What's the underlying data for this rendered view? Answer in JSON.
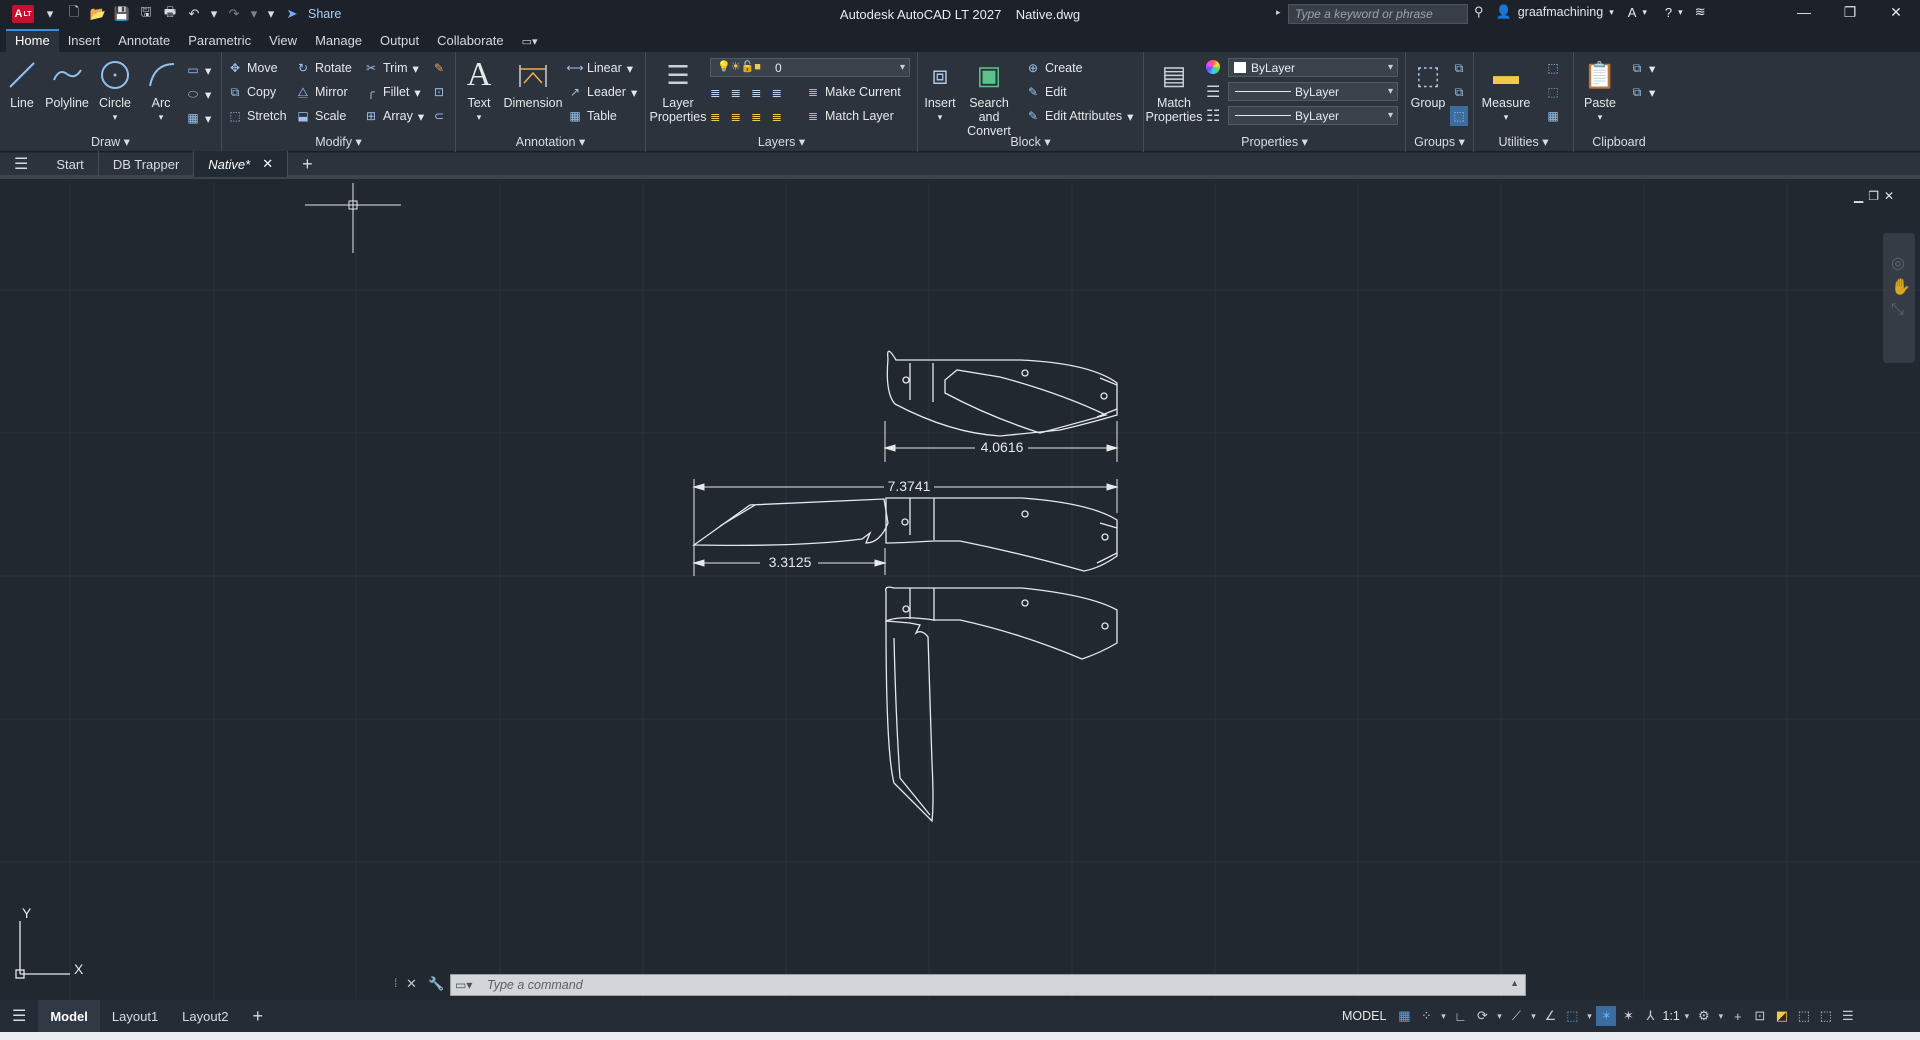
{
  "app": {
    "logo": "A",
    "logo_sub": "LT",
    "title": "Autodesk AutoCAD LT 2027    Native.dwg",
    "share_label": "Share",
    "search_placeholder": "Type a keyword or phrase",
    "user": "graafmachining"
  },
  "ribbon_tabs": [
    "Home",
    "Insert",
    "Annotate",
    "Parametric",
    "View",
    "Manage",
    "Output",
    "Collaborate"
  ],
  "ribbon": {
    "draw": {
      "title": "Draw",
      "line": "Line",
      "polyline": "Polyline",
      "circle": "Circle",
      "arc": "Arc"
    },
    "modify": {
      "title": "Modify",
      "move": "Move",
      "rotate": "Rotate",
      "trim": "Trim",
      "copy": "Copy",
      "mirror": "Mirror",
      "fillet": "Fillet",
      "stretch": "Stretch",
      "scale": "Scale",
      "array": "Array"
    },
    "annotation": {
      "title": "Annotation",
      "text": "Text",
      "dimension": "Dimension",
      "linear": "Linear",
      "leader": "Leader",
      "table": "Table"
    },
    "layers": {
      "title": "Layers",
      "layer_properties_1": "Layer",
      "layer_properties_2": "Properties",
      "current_layer": "0",
      "make_current": "Make Current",
      "match_layer": "Match Layer"
    },
    "block": {
      "title": "Block",
      "insert": "Insert",
      "search_convert_1": "Search and",
      "search_convert_2": "Convert",
      "create": "Create",
      "edit": "Edit",
      "edit_attributes": "Edit Attributes"
    },
    "properties": {
      "title": "Properties",
      "match_1": "Match",
      "match_2": "Properties",
      "color": "ByLayer",
      "linetype": "ByLayer",
      "lineweight": "ByLayer"
    },
    "groups": {
      "title": "Groups",
      "group": "Group"
    },
    "utilities": {
      "title": "Utilities",
      "measure": "Measure"
    },
    "clipboard": {
      "title": "Clipboard",
      "paste": "Paste"
    }
  },
  "file_tabs": [
    "Start",
    "DB Trapper",
    "Native*"
  ],
  "drawing": {
    "dim_top": "4.0616",
    "dim_overall": "7.3741",
    "dim_blade": "3.3125",
    "ucs_x": "X",
    "ucs_y": "Y"
  },
  "command": {
    "placeholder": "Type a command"
  },
  "layout_tabs": [
    "Model",
    "Layout1",
    "Layout2"
  ],
  "status": {
    "model": "MODEL",
    "scale": "1:1"
  }
}
